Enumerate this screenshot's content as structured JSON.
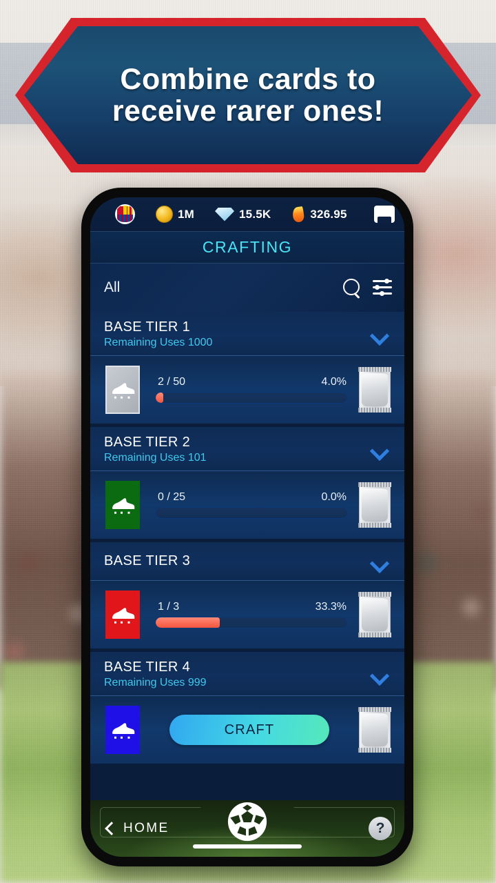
{
  "promo": {
    "headline_line1": "Combine cards to",
    "headline_line2": "receive rarer ones!",
    "border_color": "#d6242c",
    "fill_color": "#1a4a6e"
  },
  "app": {
    "topbar": {
      "club_crest": "fc-barcelona-crest",
      "currencies": [
        {
          "icon": "coin-icon",
          "value": "1M"
        },
        {
          "icon": "gem-icon",
          "value": "15.5K"
        },
        {
          "icon": "flame-icon",
          "value": "326.95"
        }
      ],
      "inbox_icon": "inbox-icon"
    },
    "title": "CRAFTING",
    "title_color": "#49e4f5",
    "filter": {
      "label": "All",
      "search_icon": "search-icon",
      "sliders_icon": "sliders-icon"
    },
    "tiers": [
      {
        "name": "BASE TIER 1",
        "remaining": "Remaining Uses 1000",
        "boot_color": "#b6bbc2",
        "boot_variant": "t1",
        "progress_text": "2 / 50",
        "percent_text": "4.0%",
        "percent_value": 4.0,
        "pack_icon": "card-pack-icon",
        "chevron_icon": "chevron-down-icon",
        "action": null
      },
      {
        "name": "BASE TIER 2",
        "remaining": "Remaining Uses 101",
        "boot_color": "#0a6b10",
        "boot_variant": "t2",
        "progress_text": "0 / 25",
        "percent_text": "0.0%",
        "percent_value": 0.0,
        "pack_icon": "card-pack-icon",
        "chevron_icon": "chevron-down-icon",
        "action": null
      },
      {
        "name": "BASE TIER 3",
        "remaining": "",
        "boot_color": "#e0161a",
        "boot_variant": "t3",
        "progress_text": "1 / 3",
        "percent_text": "33.3%",
        "percent_value": 33.3,
        "pack_icon": "card-pack-icon",
        "chevron_icon": "chevron-down-icon",
        "action": null
      },
      {
        "name": "BASE TIER 4",
        "remaining": "Remaining Uses 999",
        "boot_color": "#1f10e8",
        "boot_variant": "t4",
        "progress_text": "",
        "percent_text": "",
        "percent_value": null,
        "pack_icon": "card-pack-icon",
        "chevron_icon": "chevron-down-icon",
        "action": "CRAFT"
      }
    ],
    "bottom": {
      "home_label": "HOME",
      "back_icon": "chevron-left-icon",
      "ball_icon": "soccer-ball-icon",
      "help_label": "?"
    }
  }
}
